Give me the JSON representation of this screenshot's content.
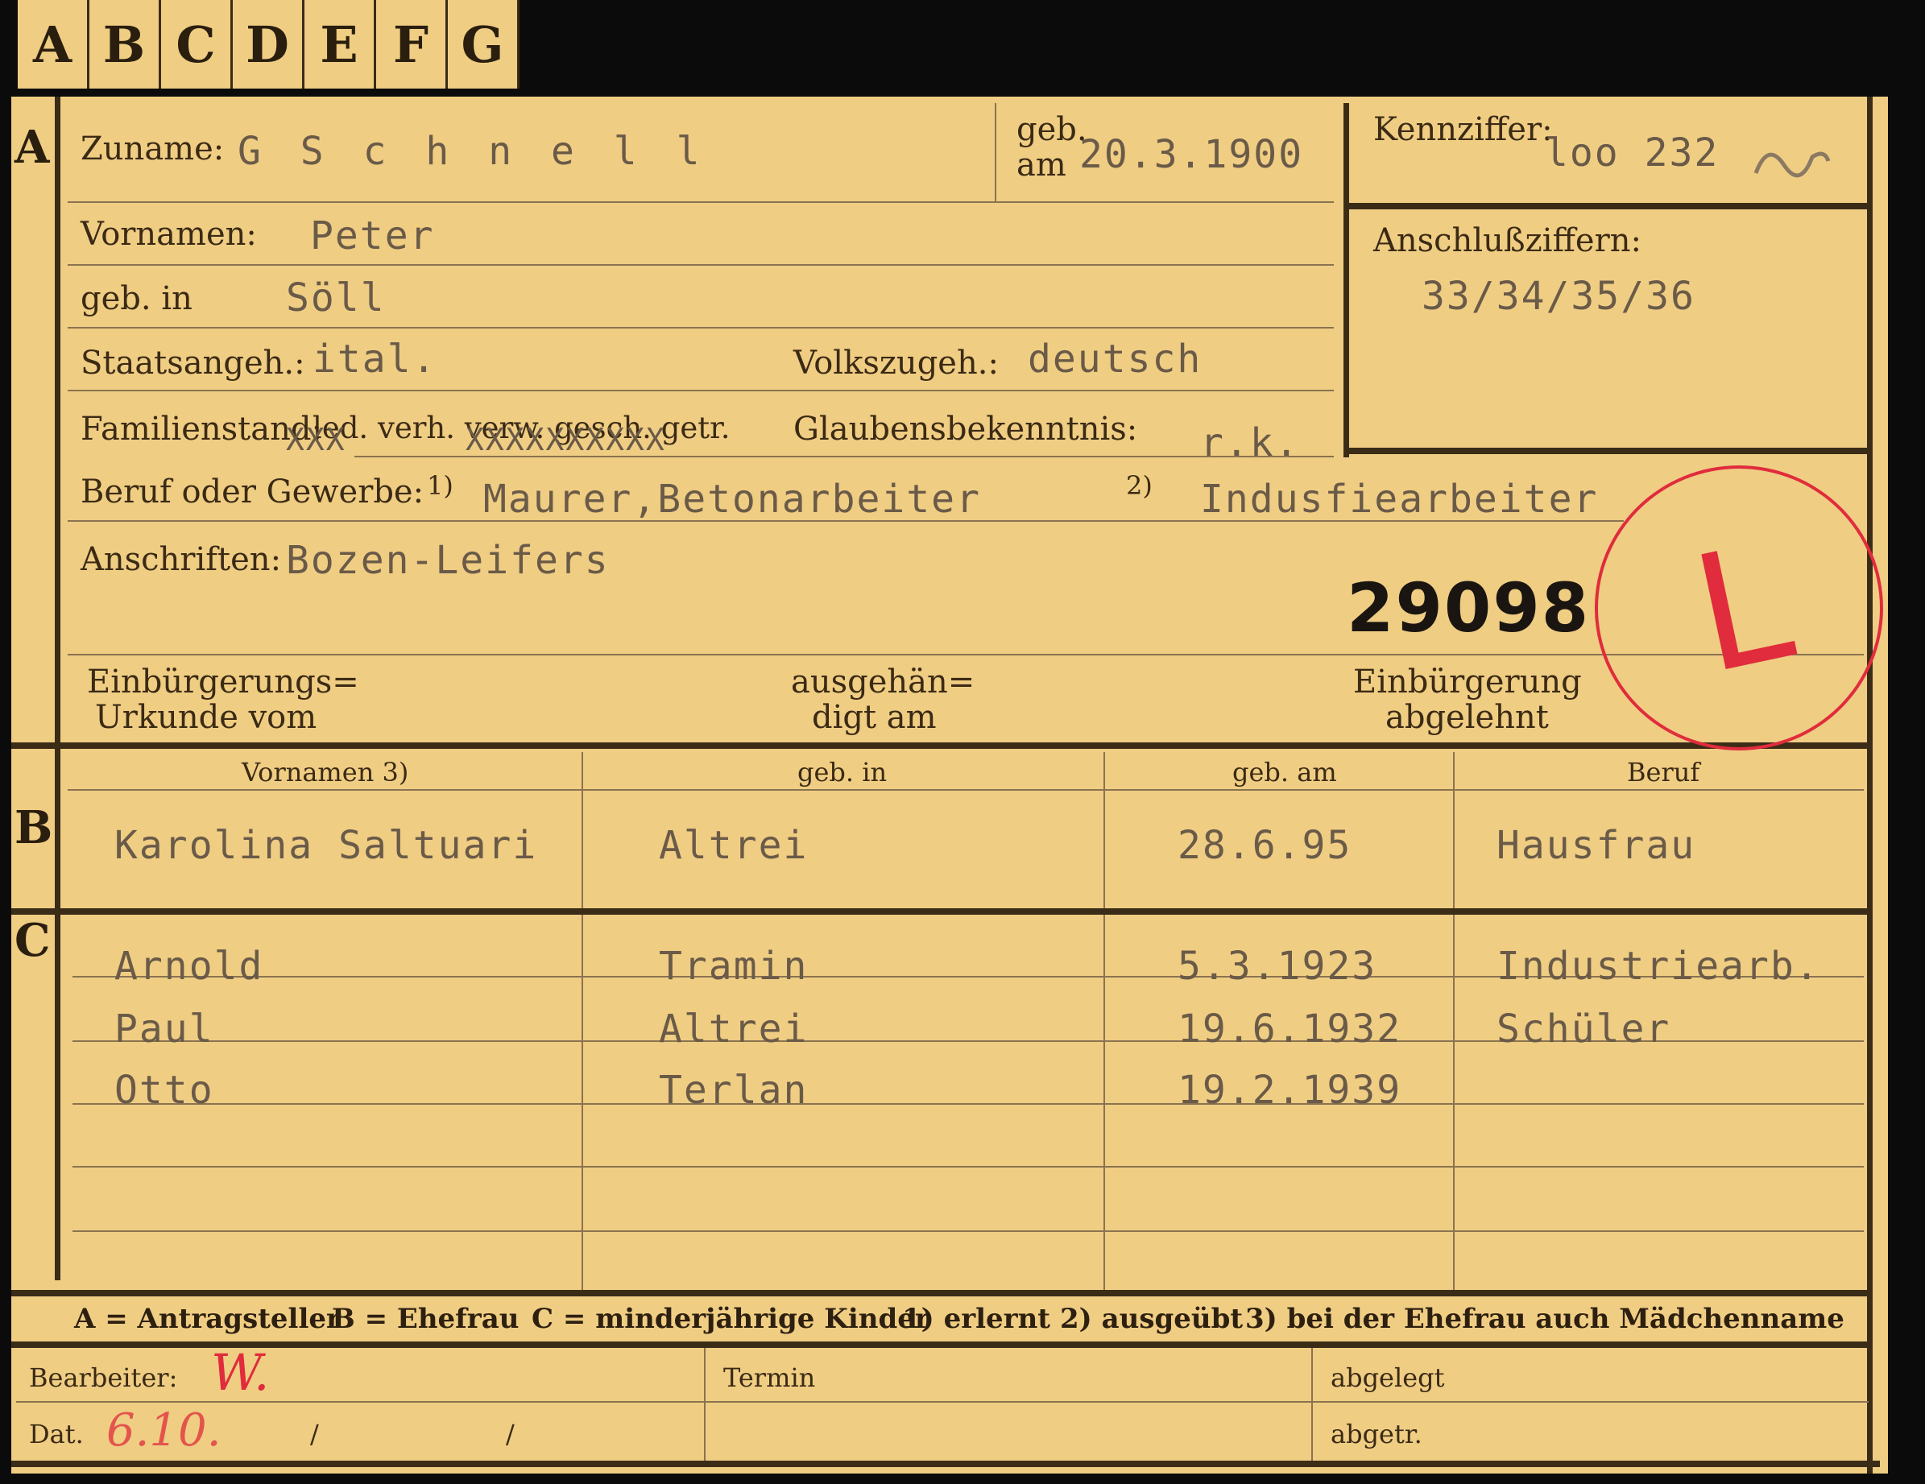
{
  "tabs": [
    "A",
    "B",
    "C",
    "D",
    "E",
    "F",
    "G"
  ],
  "sections": {
    "a": "A",
    "b": "B",
    "c": "C"
  },
  "applicant": {
    "zuname_label": "Zuname:",
    "zuname": "G S c h n e l l",
    "geb_am_label_1": "geb.",
    "geb_am_label_2": "am",
    "geb_am": "20.3.1900",
    "kennziffer_label": "Kennziffer:",
    "kennziffer": "loo 232",
    "anschluss_label": "Anschlußziffern:",
    "anschluss": "33/34/35/36",
    "vornamen_label": "Vornamen:",
    "vornamen": "Peter",
    "geb_in_label": "geb. in",
    "geb_in": "Söll",
    "staatsangeh_label": "Staatsangeh.:",
    "staatsangeh": "ital.",
    "volkszugeh_label": "Volkszugeh.:",
    "volkszugeh": "deutsch",
    "familienstand_label": "Familienstand:",
    "familienstand_options": "led. verh. verw. gesch. getr.",
    "familienstand_marks_1": "XXX",
    "familienstand_marks_2": "XXXXXXXXXX",
    "glauben_label": "Glaubensbekenntnis:",
    "glauben": "r.k.",
    "beruf_label": "Beruf oder Gewerbe:",
    "beruf_note_1": "1)",
    "beruf_1": "Maurer,Betonarbeiter",
    "beruf_note_2": "2)",
    "beruf_2": "Indusfiearbeiter",
    "anschriften_label": "Anschriften:",
    "anschriften": "Bozen-Leifers",
    "stamp_number": "29098",
    "stamp_letter": "L",
    "einb_label_1": "Einbürgerungs=",
    "einb_label_2": "Urkunde vom",
    "ausgeh_label_1": "ausgehän=",
    "ausgeh_label_2": "digt am",
    "abgelehnt_label_1": "Einbürgerung",
    "abgelehnt_label_2": "abgelehnt"
  },
  "spouse": {
    "headers": [
      "Vornamen 3)",
      "geb. in",
      "geb. am",
      "Beruf"
    ],
    "row": [
      "Karolina Saltuari",
      "Altrei",
      "28.6.95",
      "Hausfrau"
    ]
  },
  "children": [
    [
      "Arnold",
      "Tramin",
      "5.3.1923",
      "Industriearb."
    ],
    [
      "Paul",
      "Altrei",
      "19.6.1932",
      "Schüler"
    ],
    [
      "Otto",
      "Terlan",
      "19.2.1939",
      ""
    ]
  ],
  "legend": {
    "a": "A = Antragsteller",
    "b": "B = Ehefrau",
    "c": "C = minderjährige Kinder",
    "n1": "1) erlernt",
    "n2": "2) ausgeübt",
    "n3": "3) bei der Ehefrau auch Mädchenname"
  },
  "footer": {
    "bearbeiter_label": "Bearbeiter:",
    "bearbeiter": "W.",
    "dat_label": "Dat.",
    "dat": "6.10.",
    "slash": "/",
    "termin_label": "Termin",
    "abgelegt_label": "abgelegt",
    "abgetr_label": "abgetr."
  },
  "colors": {
    "card": "#efcd83",
    "ink": "#3b2c17",
    "typewriter": "#6a5a48",
    "stamp_red": "#e02c3c"
  }
}
